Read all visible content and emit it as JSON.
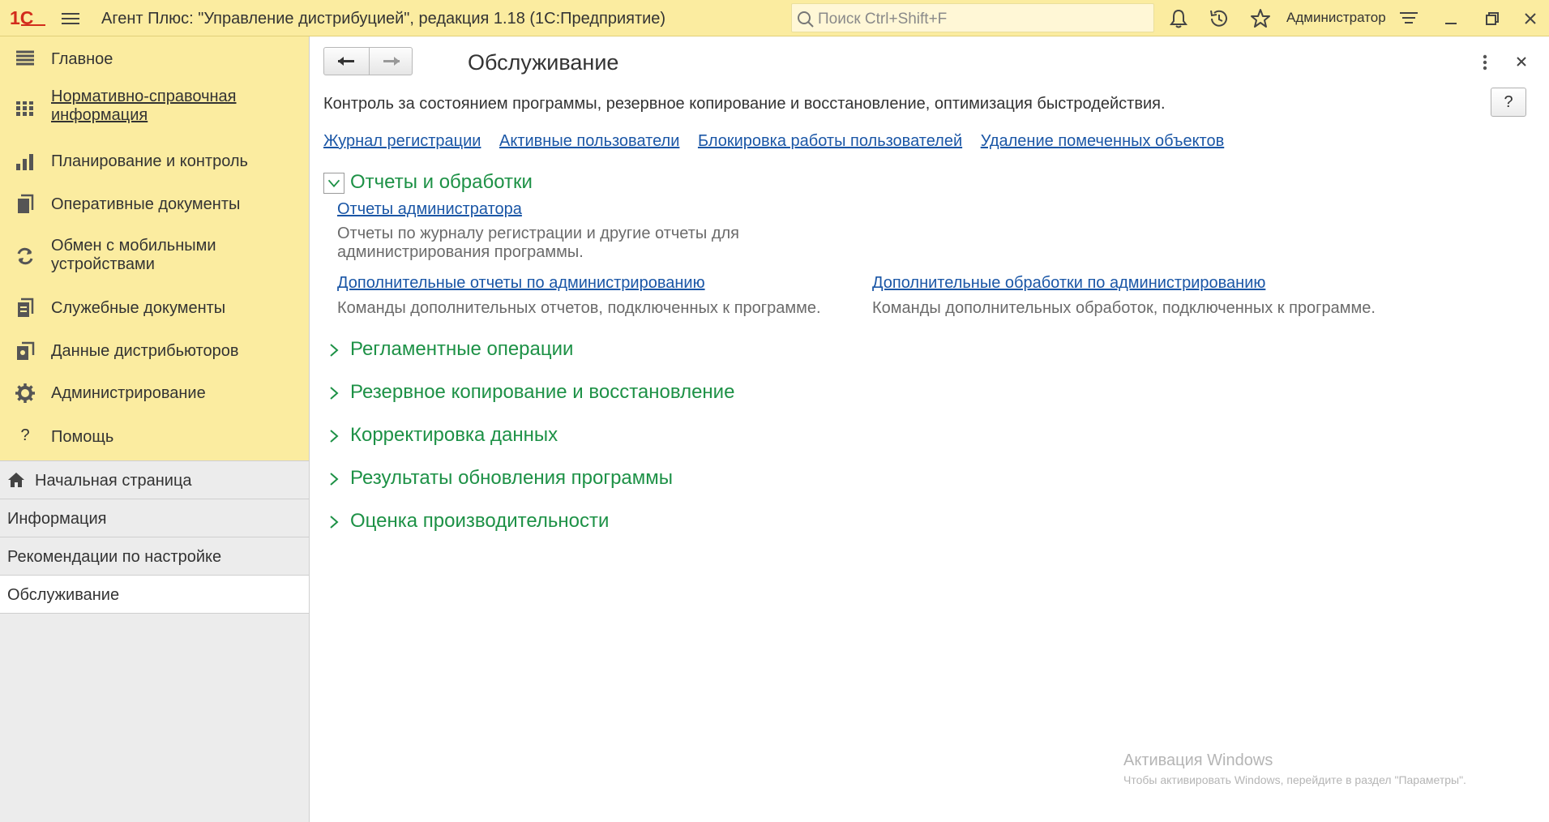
{
  "topbar": {
    "app_title": "Агент Плюс: \"Управление дистрибуцией\", редакция 1.18  (1С:Предприятие)",
    "search_placeholder": "Поиск Ctrl+Shift+F",
    "user_name": "Администратор",
    "icons": [
      "bell-icon",
      "history-icon",
      "star-icon",
      "settings-lines-icon",
      "minimize-icon",
      "restore-icon",
      "close-icon"
    ]
  },
  "sidebar": {
    "sections": [
      {
        "label": "Главное",
        "icon": "list-icon"
      },
      {
        "label": "Нормативно-справочная информация",
        "icon": "catalog-icon"
      },
      {
        "label": "Планирование и контроль",
        "icon": "chart-icon"
      },
      {
        "label": "Оперативные документы",
        "icon": "documents-icon"
      },
      {
        "label": "Обмен с мобильными устройствами",
        "icon": "sync-icon"
      },
      {
        "label": "Служебные документы",
        "icon": "service-docs-icon"
      },
      {
        "label": "Данные дистрибьюторов",
        "icon": "distributor-data-icon"
      },
      {
        "label": "Администрирование",
        "icon": "gear-icon"
      },
      {
        "label": "Помощь",
        "icon": "help-icon"
      }
    ],
    "open_windows": [
      {
        "label": "Начальная страница",
        "icon": "home-icon"
      },
      {
        "label": "Информация"
      },
      {
        "label": "Рекомендации по настройке"
      },
      {
        "label": "Обслуживание"
      }
    ]
  },
  "main": {
    "title": "Обслуживание",
    "help_label": "?",
    "description": "Контроль за состоянием программы, резервное копирование и восстановление, оптимизация быстродействия.",
    "top_links": [
      "Журнал регистрации",
      "Активные пользователи",
      "Блокировка работы пользователей",
      "Удаление помеченных объектов"
    ],
    "expanded_group": {
      "title": "Отчеты и обработки",
      "items": [
        {
          "link": "Отчеты администратора",
          "desc_line1": "Отчеты по журналу регистрации и другие отчеты для",
          "desc_line2": "администрирования программы."
        },
        {
          "link": "Дополнительные отчеты по администрированию",
          "desc_line1": "Команды дополнительных отчетов, подключенных к программе."
        },
        {
          "link": "Дополнительные обработки по администрированию",
          "desc_line1": "Команды дополнительных обработок, подключенных к программе."
        }
      ]
    },
    "collapsed_groups": [
      "Регламентные операции",
      "Резервное копирование и восстановление",
      "Корректировка данных",
      "Результаты обновления программы",
      "Оценка производительности"
    ]
  },
  "watermark": {
    "title": "Активация Windows",
    "subtitle": "Чтобы активировать Windows, перейдите в раздел \"Параметры\"."
  },
  "colors": {
    "topbar_bg": "#fbeca0",
    "link": "#1a56a6",
    "group_header": "#1d9146"
  }
}
